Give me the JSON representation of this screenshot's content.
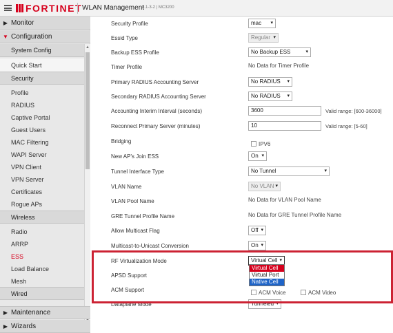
{
  "header": {
    "brand": "FORTINET",
    "title": "WLAN Management",
    "version": "8.1-3-2 | MC3200"
  },
  "sidebar": {
    "monitor": "Monitor",
    "configuration": "Configuration",
    "system_config": "System Config",
    "quick_start": "Quick Start",
    "security": "Security",
    "security_items": [
      "Profile",
      "RADIUS",
      "Captive Portal",
      "Guest Users",
      "MAC Filtering",
      "WAPI Server",
      "VPN Client",
      "VPN Server",
      "Certificates",
      "Rogue APs"
    ],
    "wireless": "Wireless",
    "wireless_items": [
      "Radio",
      "ARRP",
      "ESS",
      "Load Balance",
      "Mesh"
    ],
    "wired": "Wired",
    "maintenance": "Maintenance",
    "wizards": "Wizards"
  },
  "form": {
    "security_profile": {
      "label": "Security Profile",
      "value": "mac"
    },
    "essid_type": {
      "label": "Essid Type",
      "value": "Regular"
    },
    "backup_ess": {
      "label": "Backup ESS Profile",
      "value": "No Backup ESS"
    },
    "timer_profile": {
      "label": "Timer Profile",
      "value": "No Data for Timer Profile"
    },
    "primary_radius": {
      "label": "Primary RADIUS Accounting Server",
      "value": "No RADIUS"
    },
    "secondary_radius": {
      "label": "Secondary RADIUS Accounting Server",
      "value": "No RADIUS"
    },
    "acct_interval": {
      "label": "Accounting Interim Interval (seconds)",
      "value": "3600",
      "hint": "Valid range: [600-36000]"
    },
    "reconnect": {
      "label": "Reconnect Primary Server (minutes)",
      "value": "10",
      "hint": "Valid range: [5-60]"
    },
    "bridging": {
      "label": "Bridging",
      "option": "IPV6"
    },
    "new_ap_join": {
      "label": "New AP's Join ESS",
      "value": "On"
    },
    "tunnel_iface": {
      "label": "Tunnel Interface Type",
      "value": "No Tunnel"
    },
    "vlan_name": {
      "label": "VLAN Name",
      "value": "No VLAN"
    },
    "vlan_pool": {
      "label": "VLAN Pool Name",
      "value": "No Data for VLAN Pool Name"
    },
    "gre_tunnel": {
      "label": "GRE Tunnel Profile Name",
      "value": "No Data for GRE Tunnel Profile Name"
    },
    "allow_multicast": {
      "label": "Allow Multicast Flag",
      "value": "Off"
    },
    "mc_to_uc": {
      "label": "Multicast-to-Unicast Conversion",
      "value": "On"
    },
    "rf_virt": {
      "label": "RF Virtualization Mode",
      "value": "Virtual Cell",
      "options": [
        "Virtual Cell",
        "Virtual Port",
        "Native Cell"
      ]
    },
    "apsd": {
      "label": "APSD Support"
    },
    "acm": {
      "label": "ACM Support",
      "voice": "ACM Voice",
      "video": "ACM Video"
    },
    "dataplane": {
      "label": "Dataplane Mode",
      "value": "Tunneled"
    }
  },
  "colors": {
    "brand_red": "#d6001c",
    "highlight": "#cc2233",
    "selected_blue": "#1e64c8"
  }
}
